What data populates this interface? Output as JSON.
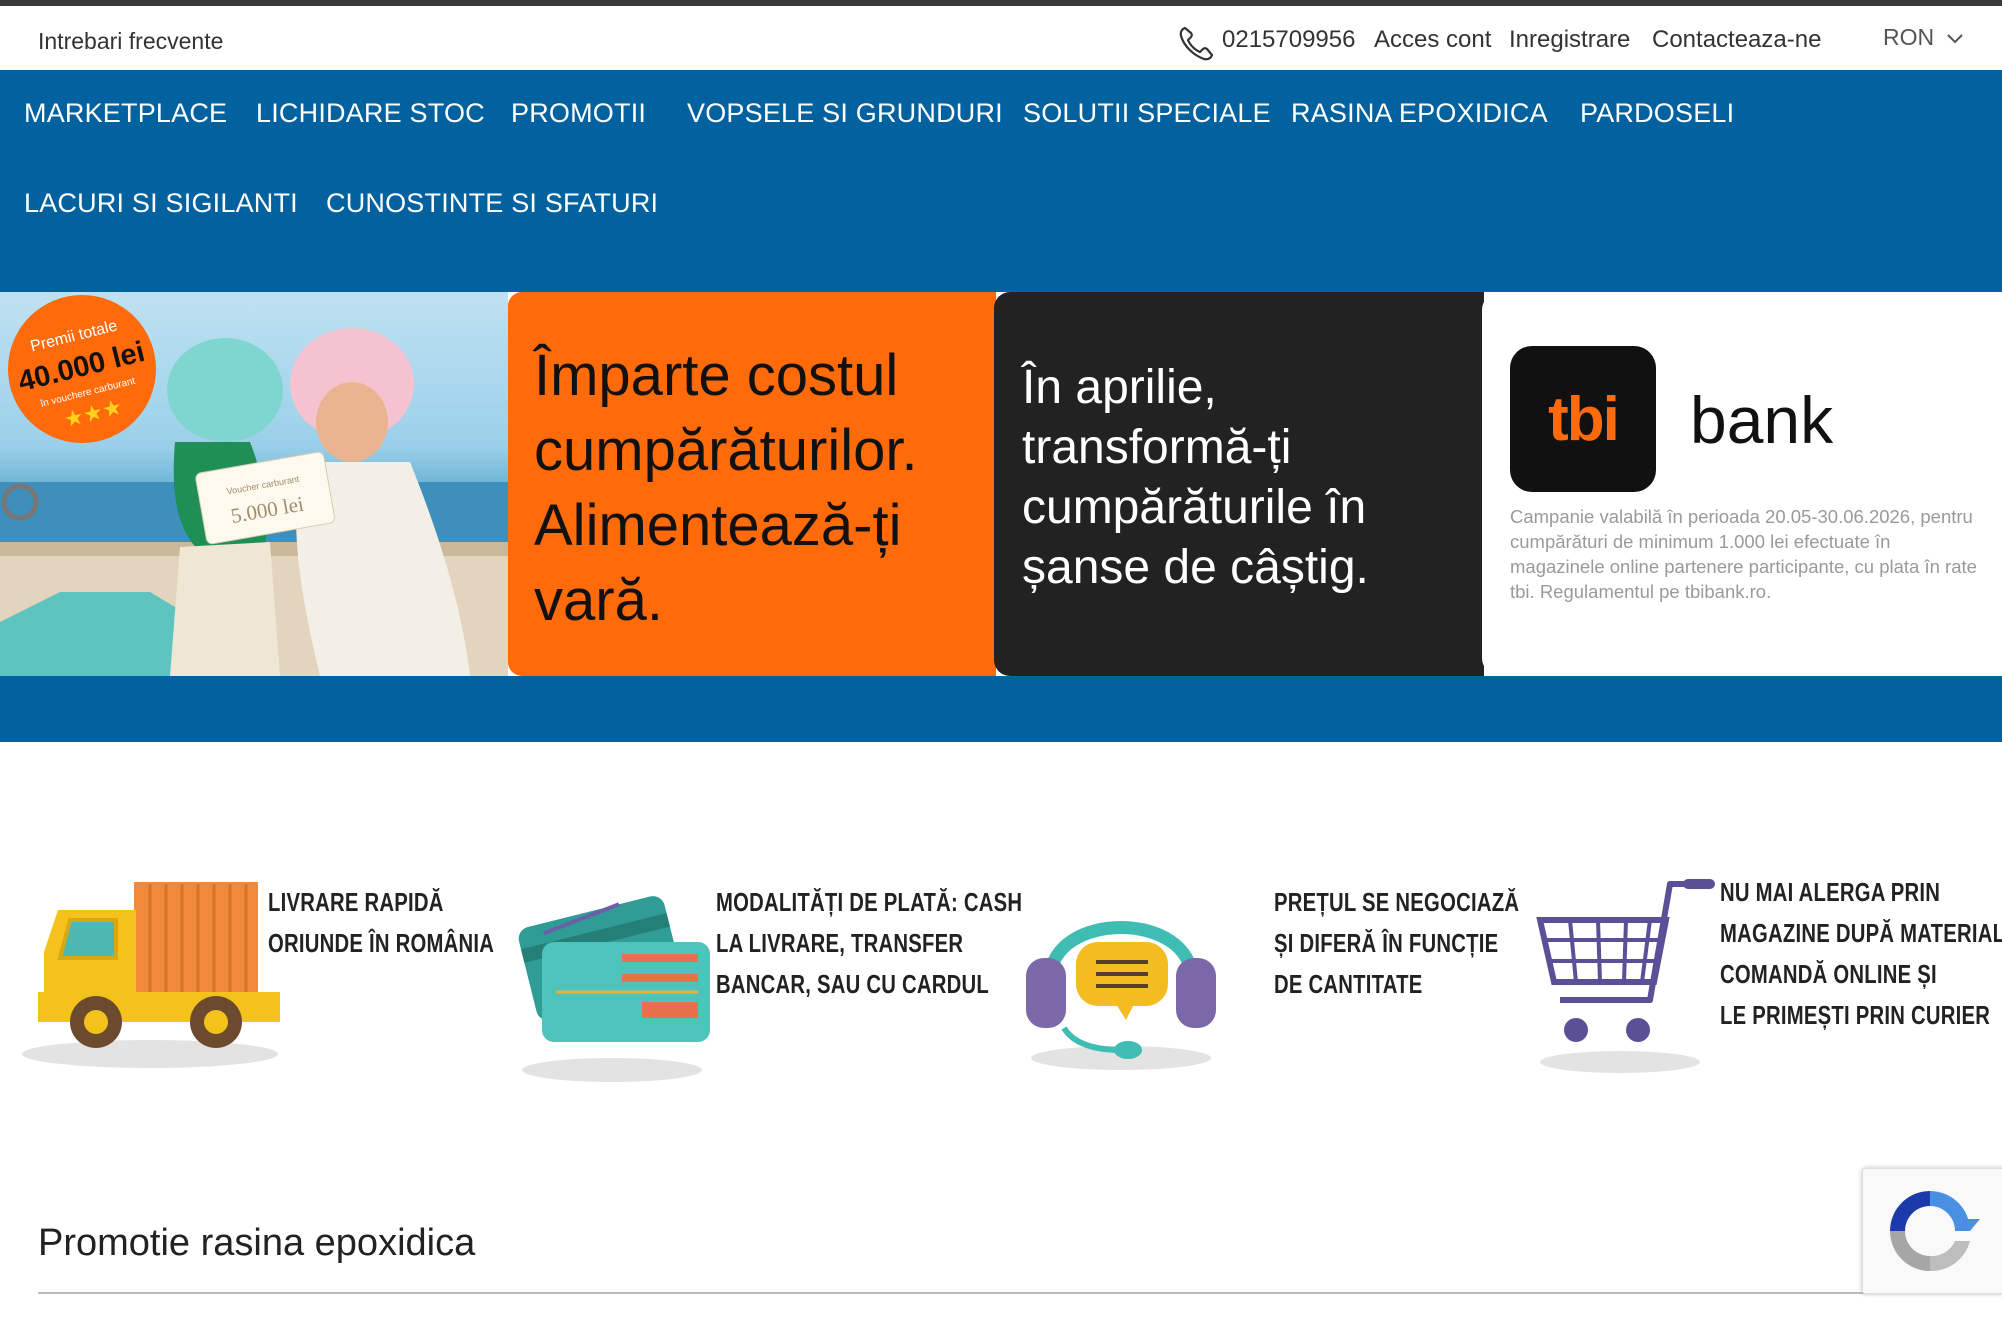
{
  "topbar": {
    "faq": "Intrebari frecvente",
    "phone": "0215709956",
    "login": "Acces cont",
    "register": "Inregistrare",
    "contact": "Contacteaza-ne",
    "currency": "RON"
  },
  "nav": {
    "items": [
      "MARKETPLACE",
      "LICHIDARE STOC",
      "PROMOTII",
      "VOPSELE SI GRUNDURI",
      "SOLUTII SPECIALE",
      "RASINA EPOXIDICA",
      "PARDOSELI",
      "LACURI SI SIGILANTI",
      "CUNOSTINTE SI SFATURI"
    ]
  },
  "banner": {
    "badge_line1": "Premii totale",
    "badge_line2": "40.000 lei",
    "badge_line3": "în vouchere carburant",
    "voucher_line1": "Voucher carburant",
    "voucher_line2": "5.000 lei",
    "orange_text": [
      "Împarte costul",
      "cumpărăturilor.",
      "Alimentează-ți",
      "vară."
    ],
    "dark_text": [
      "În aprilie,",
      "transformă-ți",
      "cumpărăturile în",
      "șanse de câștig."
    ],
    "logo_text": "tbi",
    "bank_word": "bank",
    "disclaimer": "Campanie valabilă în perioada 20.05-30.06.2026, pentru cumpărături de minimum 1.000 lei efectuate în magazinele online partenere participante, cu plata în rate tbi. Regulamentul pe tbibank.ro.",
    "colors": {
      "orange": "#ff6a0a",
      "dark": "#222222",
      "brand_blue": "#0262a0"
    }
  },
  "features": [
    {
      "icon": "delivery-truck-icon",
      "lines": [
        "LIVRARE RAPIDĂ",
        "ORIUNDE ÎN ROMÂNIA"
      ]
    },
    {
      "icon": "payment-card-icon",
      "lines": [
        "MODALITĂȚI DE PLATĂ: CASH",
        "LA LIVRARE, TRANSFER",
        "BANCAR, SAU CU CARDUL"
      ]
    },
    {
      "icon": "support-headset-icon",
      "lines": [
        "PREȚUL SE NEGOCIAZĂ",
        "ȘI DIFERĂ ÎN FUNCȚIE",
        "DE CANTITATE"
      ]
    },
    {
      "icon": "shopping-cart-icon",
      "lines": [
        "NU MAI ALERGA PRIN",
        "MAGAZINE DUPĂ MATERIALE.",
        "COMANDĂ ONLINE ȘI",
        "LE PRIMEȘTI PRIN CURIER"
      ]
    }
  ],
  "section": {
    "title": "Promotie rasina epoxidica"
  }
}
